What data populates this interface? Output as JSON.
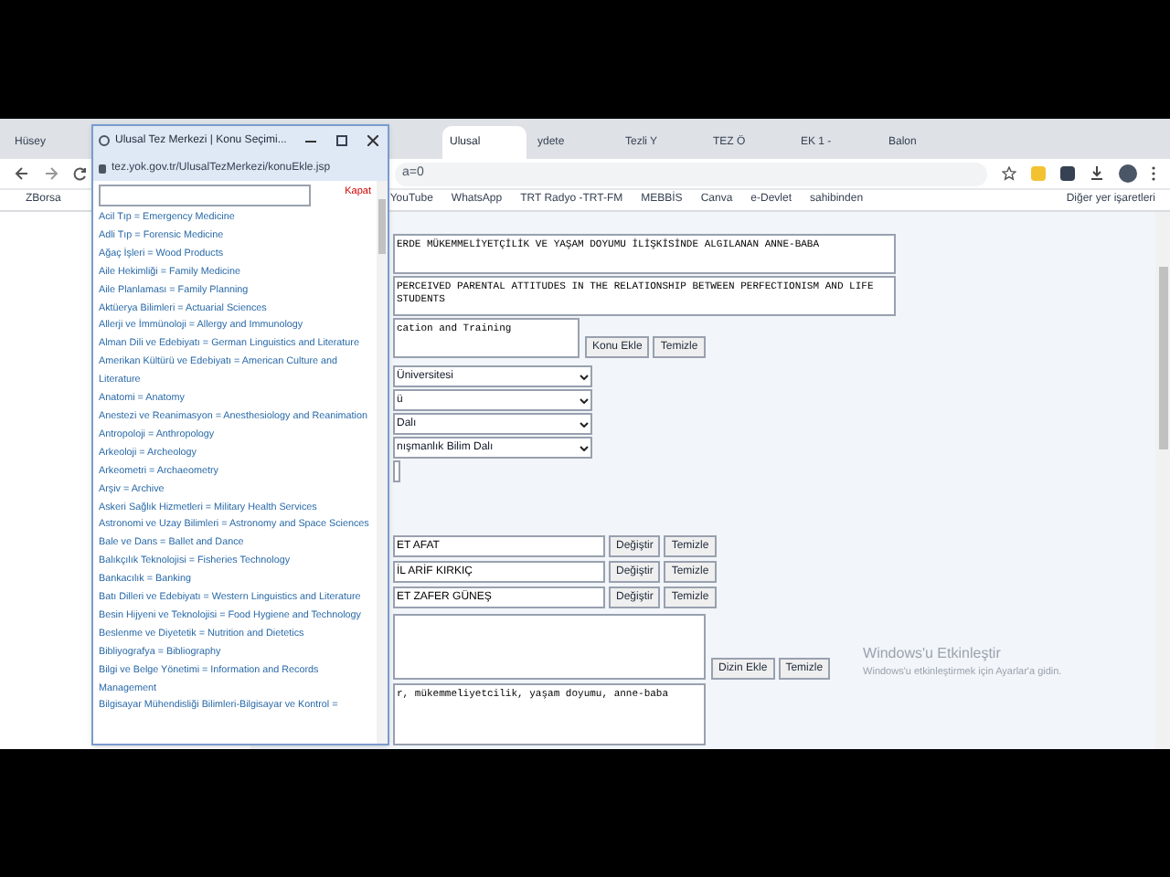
{
  "browser": {
    "tabs": [
      {
        "label": "Hüsey",
        "selected": false
      },
      {
        "label": "Ulusal",
        "selected": true
      },
      {
        "label": "ydete",
        "selected": false
      },
      {
        "label": "Tezli Y",
        "selected": false
      },
      {
        "label": "TEZ Ö",
        "selected": false
      },
      {
        "label": "EK 1 -",
        "selected": false
      },
      {
        "label": "Balon",
        "selected": false
      }
    ],
    "address": "a=0",
    "bookmarks": [
      "ZBorsa",
      "YouTube",
      "WhatsApp",
      "TRT Radyo -TRT-FM",
      "MEBBİS",
      "Canva",
      "e-Devlet",
      "sahibinden"
    ],
    "other_bookmarks": "Diğer yer işaretleri"
  },
  "popup": {
    "title": "Ulusal Tez Merkezi | Konu Seçimi...",
    "url": "tez.yok.gov.tr/UlusalTezMerkezi/konuEkle.jsp",
    "close_link": "Kapat",
    "topics": [
      "Acil Tıp = Emergency Medicine",
      "Adli Tıp = Forensic Medicine",
      "Ağaç İşleri = Wood Products",
      "Aile Hekimliği = Family Medicine",
      "Aile Planlaması = Family Planning",
      "Aktüerya Bilimleri = Actuarial Sciences",
      "Allerji ve İmmünoloji = Allergy and Immunology",
      "Alman Dili ve Edebiyatı = German Linguistics and Literature",
      "Amerikan Kültürü ve Edebiyatı = American Culture and Literature",
      "Anatomi = Anatomy",
      "Anestezi ve Reanimasyon = Anesthesiology and Reanimation",
      "Antropoloji = Anthropology",
      "Arkeoloji = Archeology",
      "Arkeometri = Archaeometry",
      "Arşiv = Archive",
      "Askeri Sağlık Hizmetleri = Military Health Services",
      "Astronomi ve Uzay Bilimleri = Astronomy and Space Sciences",
      "Bale ve Dans = Ballet and Dance",
      "Balıkçılık Teknolojisi = Fisheries Technology",
      "Bankacılık = Banking",
      "Batı Dilleri ve Edebiyatı = Western Linguistics and Literature",
      "Besin Hijyeni ve Teknolojisi = Food Hygiene and Technology",
      "Beslenme ve Diyetetik = Nutrition and Dietetics",
      "Bibliyografya = Bibliography",
      "Bilgi ve Belge Yönetimi = Information and Records Management",
      "Bilgisayar Mühendisliği Bilimleri-Bilgisayar ve Kontrol ="
    ]
  },
  "form": {
    "title_tr": "ERDE MÜKEMMELİYETÇİLİK VE YAŞAM DOYUMU İLİŞKİSİNDE ALGILANAN ANNE-BABA",
    "title_en": "PERCEIVED PARENTAL ATTITUDES IN THE RELATIONSHIP BETWEEN PERFECTIONISM AND LIFE\nSTUDENTS",
    "topic": "cation and Training",
    "topic_buttons": [
      "Konu Ekle",
      "Temizle"
    ],
    "selects": [
      "Üniversitesi",
      "ü",
      "Dalı",
      "nışmanlık Bilim Dalı"
    ],
    "people": [
      {
        "name": "ET AFAT",
        "buttons": [
          "Değiştir",
          "Temizle"
        ]
      },
      {
        "name": "İL ARİF KIRKIÇ",
        "buttons": [
          "Değiştir",
          "Temizle"
        ]
      },
      {
        "name": "ET ZAFER GÜNEŞ",
        "buttons": [
          "Değiştir",
          "Temizle"
        ]
      }
    ],
    "index_buttons": [
      "Dizin Ekle",
      "Temizle"
    ],
    "keywords": "r, mükemmeliyetcilik, yaşam doyumu, anne-baba"
  },
  "activation": {
    "title": "Windows'u Etkinleştir",
    "text": "Windows'u etkinleştirmek için Ayarlar'a gidin."
  }
}
